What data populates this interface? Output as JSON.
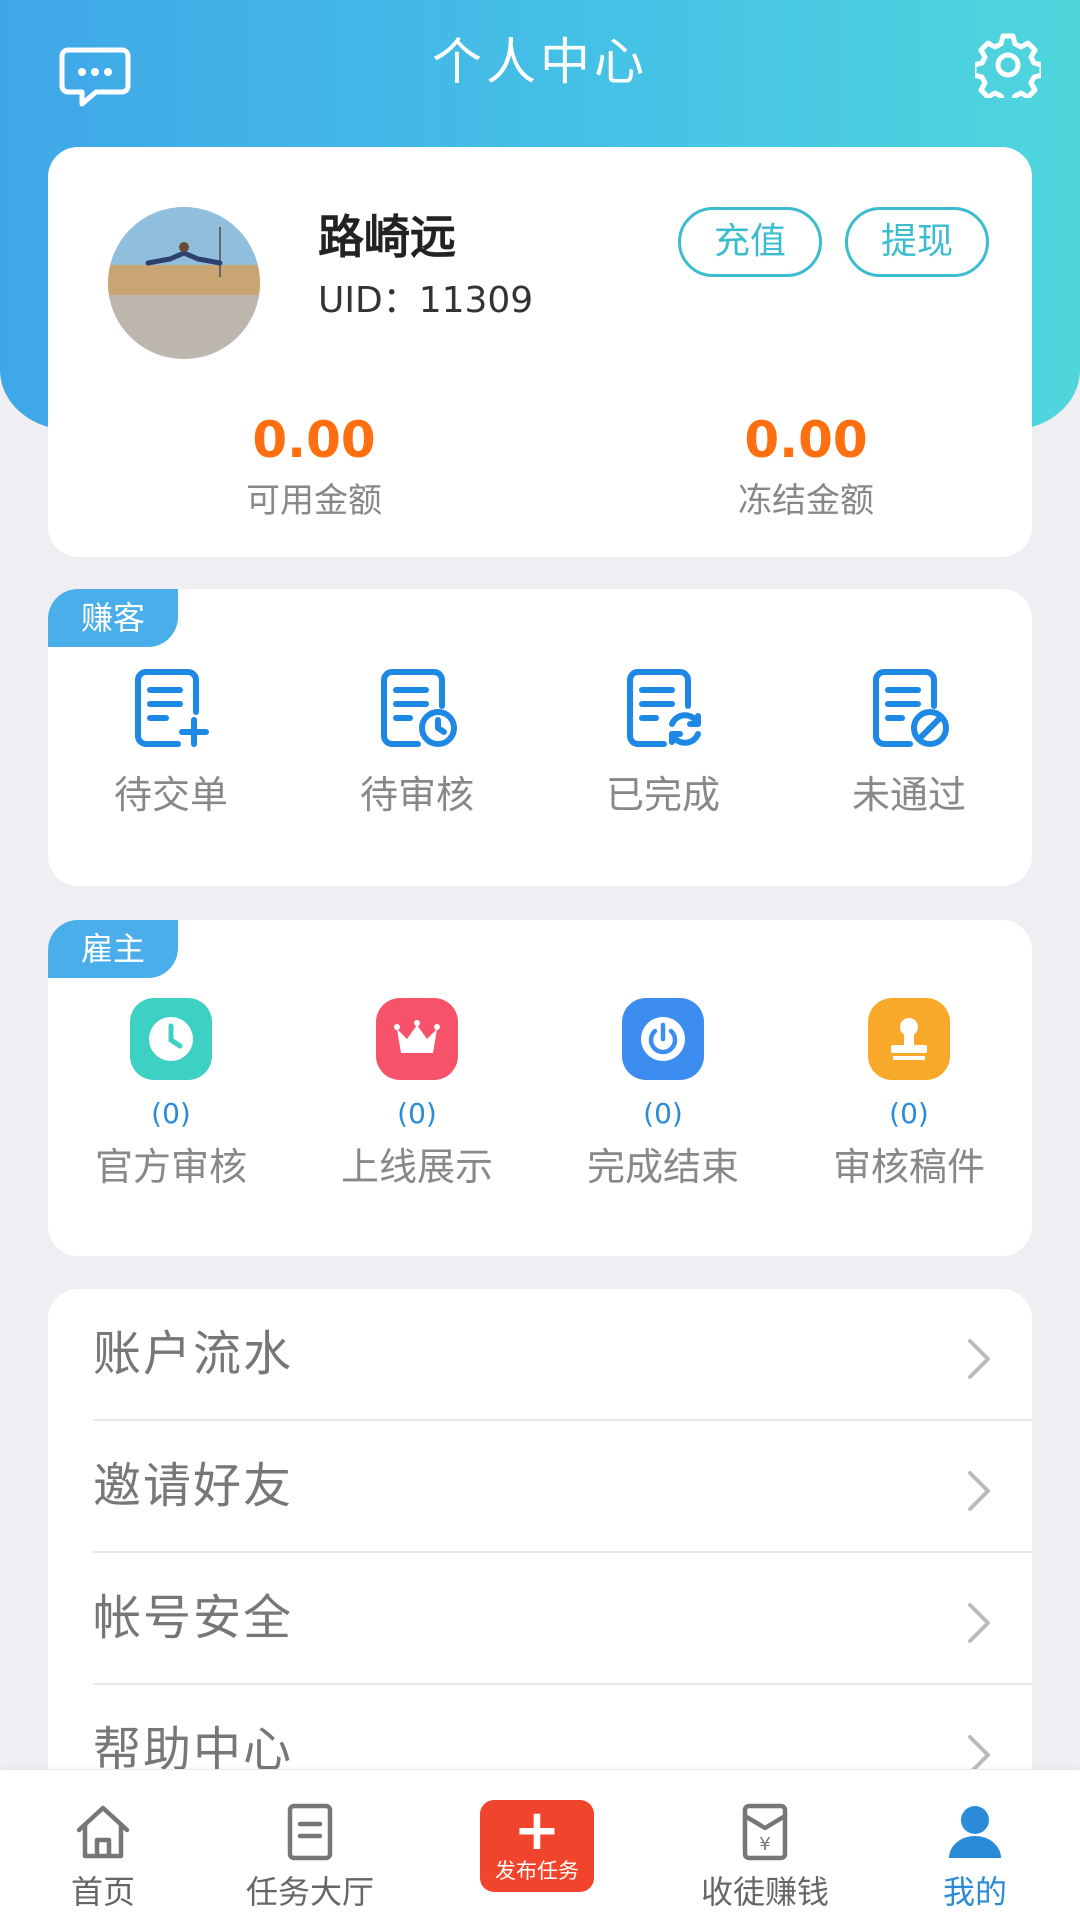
{
  "header": {
    "title": "个人中心",
    "left_icon": "chat-bubble-icon",
    "right_icon": "gear-icon"
  },
  "profile": {
    "name": "路崎远",
    "uid": "UID：11309",
    "recharge_label": "充值",
    "withdraw_label": "提现",
    "available": {
      "amount": "0.00",
      "label": "可用金额"
    },
    "frozen": {
      "amount": "0.00",
      "label": "冻结金额"
    }
  },
  "worker": {
    "tag": "赚客",
    "items": [
      {
        "label": "待交单",
        "icon": "doc-add-icon"
      },
      {
        "label": "待审核",
        "icon": "doc-clock-icon"
      },
      {
        "label": "已完成",
        "icon": "doc-refresh-icon"
      },
      {
        "label": "未通过",
        "icon": "doc-forbidden-icon"
      }
    ]
  },
  "employer": {
    "tag": "雇主",
    "items": [
      {
        "label": "官方审核",
        "count": "(0)",
        "icon": "clock-icon",
        "color": "#3dd1c3"
      },
      {
        "label": "上线展示",
        "count": "(0)",
        "icon": "crown-icon",
        "color": "#f6526a"
      },
      {
        "label": "完成结束",
        "count": "(0)",
        "icon": "power-icon",
        "color": "#3d8cf0"
      },
      {
        "label": "审核稿件",
        "count": "(0)",
        "icon": "stamp-icon",
        "color": "#f8a92a"
      }
    ]
  },
  "menu": [
    {
      "label": "账户流水"
    },
    {
      "label": "邀请好友"
    },
    {
      "label": "帐号安全"
    },
    {
      "label": "帮助中心"
    }
  ],
  "tabbar": {
    "home": "首页",
    "tasks": "任务大厅",
    "publish": "发布任务",
    "invite": "收徒赚钱",
    "mine": "我的",
    "active_color": "#2a8bd8",
    "publish_color": "#f0442c"
  },
  "colors": {
    "accent": "#3cbccf",
    "amount": "#ff6f0f",
    "tag": "#4aaeea"
  }
}
